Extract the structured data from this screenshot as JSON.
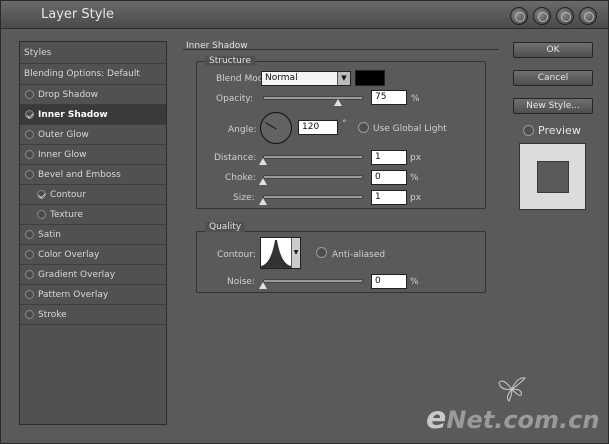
{
  "window": {
    "title": "Layer Style"
  },
  "styles_panel": {
    "header": "Styles",
    "blending": "Blending Options: Default",
    "items": [
      {
        "label": "Drop Shadow",
        "checked": false
      },
      {
        "label": "Inner Shadow",
        "checked": true,
        "selected": true
      },
      {
        "label": "Outer Glow",
        "checked": false
      },
      {
        "label": "Inner Glow",
        "checked": false
      },
      {
        "label": "Bevel and Emboss",
        "checked": false
      },
      {
        "label": "Contour",
        "checked": true,
        "sub": true
      },
      {
        "label": "Texture",
        "checked": false,
        "sub": true
      },
      {
        "label": "Satin",
        "checked": false
      },
      {
        "label": "Color Overlay",
        "checked": false
      },
      {
        "label": "Gradient Overlay",
        "checked": false
      },
      {
        "label": "Pattern Overlay",
        "checked": false
      },
      {
        "label": "Stroke",
        "checked": false
      }
    ]
  },
  "inner_shadow": {
    "section_title": "Inner Shadow",
    "structure": {
      "title": "Structure",
      "blend_mode_label": "Blend Mode:",
      "blend_mode_value": "Normal",
      "color": "#000000",
      "opacity_label": "Opacity:",
      "opacity_value": "75",
      "opacity_unit": "%",
      "angle_label": "Angle:",
      "angle_value": "120",
      "angle_unit": "°",
      "global_light_label": "Use Global Light",
      "distance_label": "Distance:",
      "distance_value": "1",
      "distance_unit": "px",
      "choke_label": "Choke:",
      "choke_value": "0",
      "choke_unit": "%",
      "size_label": "Size:",
      "size_value": "1",
      "size_unit": "px"
    },
    "quality": {
      "title": "Quality",
      "contour_label": "Contour:",
      "anti_aliased_label": "Anti-aliased",
      "noise_label": "Noise:",
      "noise_value": "0",
      "noise_unit": "%"
    }
  },
  "buttons": {
    "ok": "OK",
    "cancel": "Cancel",
    "new_style": "New Style...",
    "preview": "Preview"
  },
  "watermark": {
    "e": "e",
    "rest": "Net.com.cn"
  }
}
